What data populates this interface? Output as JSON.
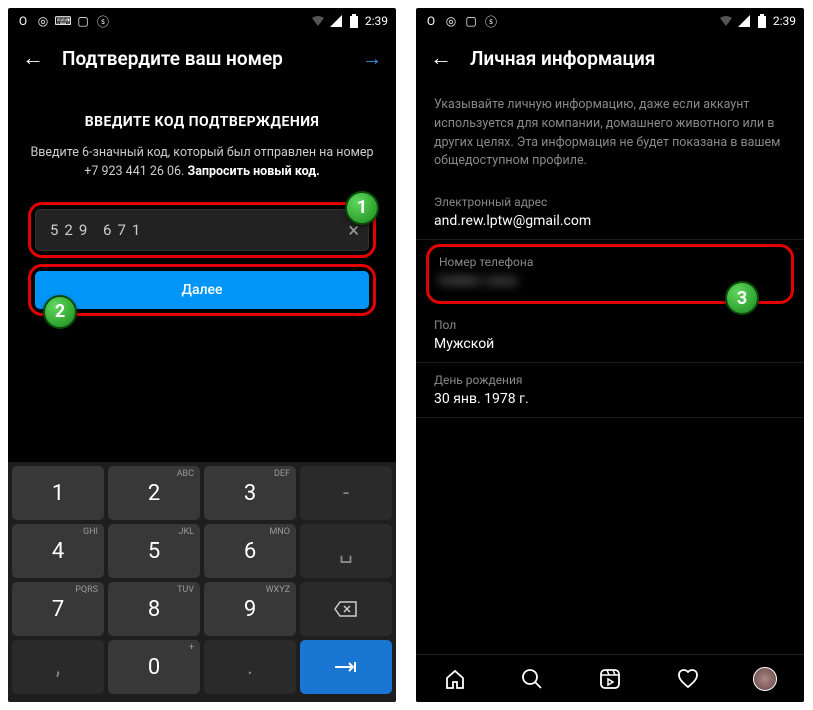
{
  "statusbar": {
    "time": "2:39"
  },
  "screen1": {
    "title": "Подтвердите ваш номер",
    "heading": "ВВЕДИТЕ КОД ПОДТВЕРЖДЕНИЯ",
    "instruction": "Введите 6-значный код, который был отправлен на номер",
    "phone": "+7 923 441 26 06.",
    "resend": "Запросить новый код.",
    "code": "529 671",
    "next_btn": "Далее",
    "badges": {
      "one": "1",
      "two": "2"
    },
    "keys": {
      "r1": [
        "1",
        "2",
        "3",
        "-"
      ],
      "r2": [
        "4",
        "5",
        "6",
        ""
      ],
      "r3": [
        "7",
        "8",
        "9",
        "⌫"
      ],
      "r4": [
        ",",
        "0",
        ".",
        "→|"
      ]
    }
  },
  "screen2": {
    "title": "Личная информация",
    "description": "Указывайте личную информацию, даже если аккаунт используется для компании, домашнего животного или в других целях. Эта информация не будет показана в вашем общедоступном профиле.",
    "email_label": "Электронный адрес",
    "email_value": "and.rew.lptw@gmail.com",
    "phone_label": "Номер телефона",
    "phone_value": "hidden value",
    "gender_label": "Пол",
    "gender_value": "Мужской",
    "birthday_label": "День рождения",
    "birthday_value": "30 янв. 1978 г.",
    "badge_three": "3"
  }
}
